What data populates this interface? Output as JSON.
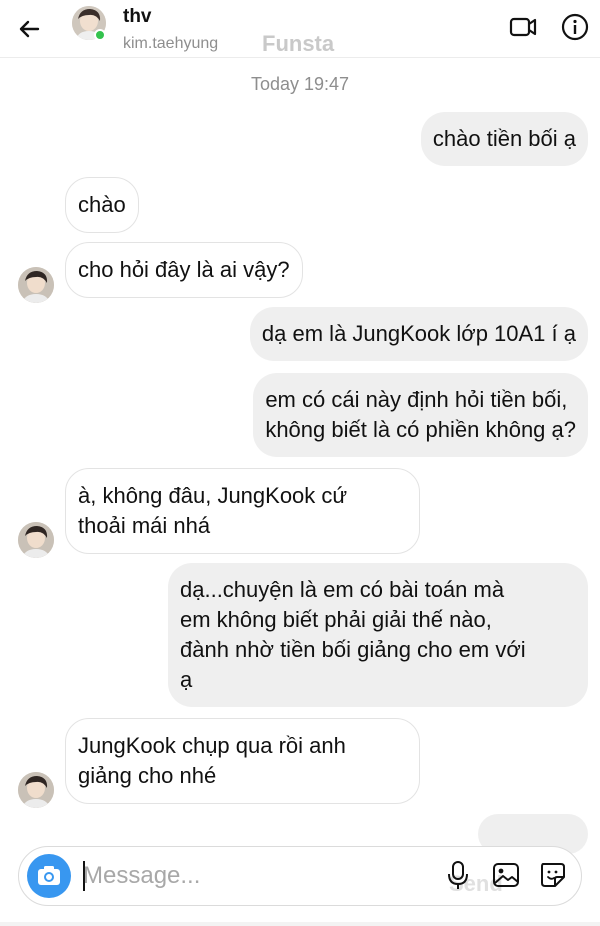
{
  "header": {
    "name": "thv",
    "username": "kim.taehyung",
    "watermark": "Funsta",
    "icons": [
      "back-arrow-icon",
      "avatar",
      "video-call-icon",
      "info-icon"
    ],
    "online_color": "#33c24d"
  },
  "timestamp": "Today 19:47",
  "messages": [
    {
      "from": "me",
      "text": "chào tiền bối ạ"
    },
    {
      "from": "them",
      "text": "chào"
    },
    {
      "from": "them",
      "text": "cho hỏi đây là ai vậy?"
    },
    {
      "from": "me",
      "text": "dạ em là JungKook lớp 10A1 í ạ"
    },
    {
      "from": "me",
      "text": "em có cái này định hỏi tiền bối,\nkhông biết là có phiền không ạ?"
    },
    {
      "from": "them",
      "text": "à, không đâu, JungKook cứ\nthoải mái nhá"
    },
    {
      "from": "me",
      "text": "dạ...chuyện là em có bài toán mà\nem không biết phải giải thế nào,\nđành nhờ tiền bối giảng cho em với\nạ"
    },
    {
      "from": "them",
      "text": "JungKook chụp qua rồi anh\ngiảng cho nhé"
    }
  ],
  "composer": {
    "placeholder": "Message...",
    "value": "",
    "send_ghost": "Send",
    "icons": [
      "camera-icon",
      "microphone-icon",
      "gallery-icon",
      "sticker-icon"
    ],
    "accent": "#3897f0"
  }
}
